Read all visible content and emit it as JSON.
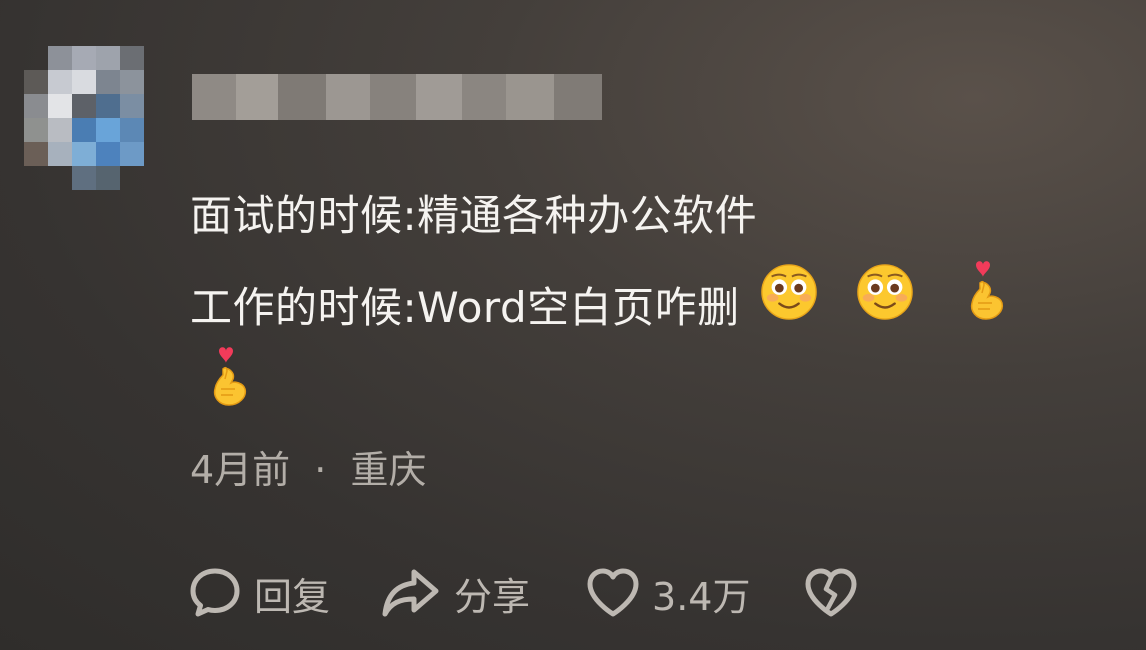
{
  "comment": {
    "line1": "面试的时候:精通各种办公软件",
    "line2": "工作的时候:Word空白页咋删",
    "emojis": [
      "flushed-face",
      "flushed-face",
      "heart-hands",
      "heart-hands"
    ],
    "time": "4月前",
    "separator": "·",
    "location": "重庆"
  },
  "actions": {
    "reply_label": "回复",
    "share_label": "分享",
    "like_count": "3.4万"
  },
  "colors": {
    "text": "#f5f3f0",
    "meta": "#b3aea8",
    "icons": "#bdb8b2"
  }
}
